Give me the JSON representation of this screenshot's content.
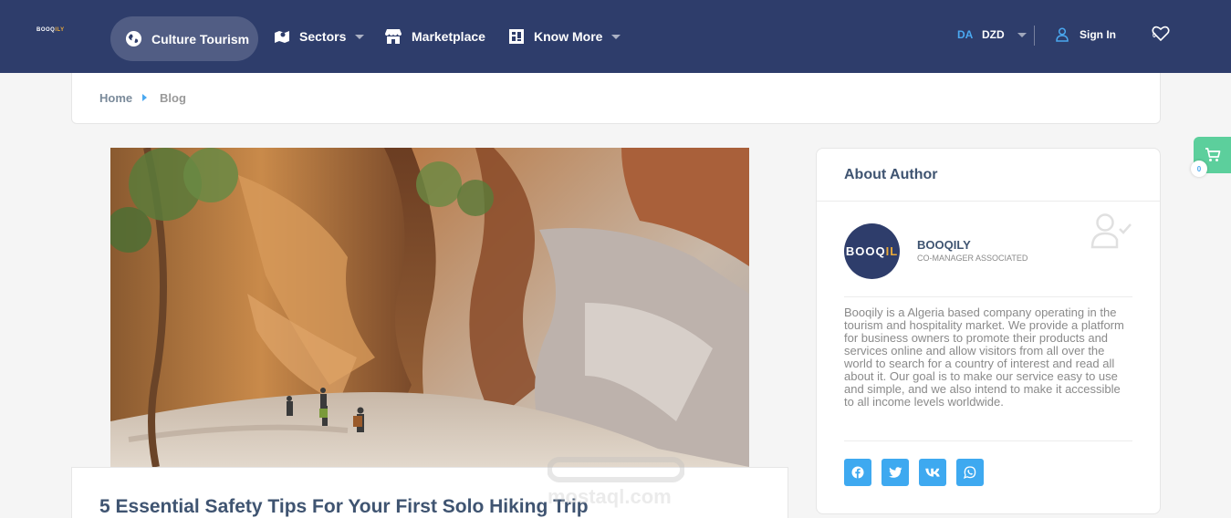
{
  "brand": {
    "logo_main": "BOOQ",
    "logo_accent": "ILY"
  },
  "nav": {
    "culture": "Culture Tourism",
    "sectors": "Sectors",
    "marketplace": "Marketplace",
    "know_more": "Know More",
    "lang": "DA",
    "currency": "DZD",
    "sign_in": "Sign In",
    "wishlist_count": "0"
  },
  "breadcrumb": {
    "home": "Home",
    "current": "Blog"
  },
  "article": {
    "title": "5 Essential Safety Tips For Your First Solo Hiking Trip"
  },
  "watermark": {
    "text": "mostaql.com"
  },
  "author": {
    "heading": "About Author",
    "avatar_main": "BOOQ",
    "avatar_accent": "IL",
    "name": "BOOQILY",
    "role": "CO-MANAGER ASSOCIATED",
    "bio": "Booqily is a Algeria based company operating in the tourism and hospitality market. We provide a platform for business owners to promote their products and services online and allow visitors from all over the world to search for a country of interest and read all about it. Our goal is to make our service easy to use and simple, and we also intend to make it accessible to all income levels worldwide."
  },
  "social": [
    {
      "icon": "facebook-icon"
    },
    {
      "icon": "twitter-icon"
    },
    {
      "icon": "vk-icon"
    },
    {
      "icon": "whatsapp-icon"
    }
  ],
  "cart": {
    "count": "0"
  },
  "colors": {
    "nav_bg": "#2e3d6b",
    "accent_blue": "#3ea9f0",
    "cart_green": "#5ccf9c",
    "logo_accent": "#e9a93a"
  }
}
